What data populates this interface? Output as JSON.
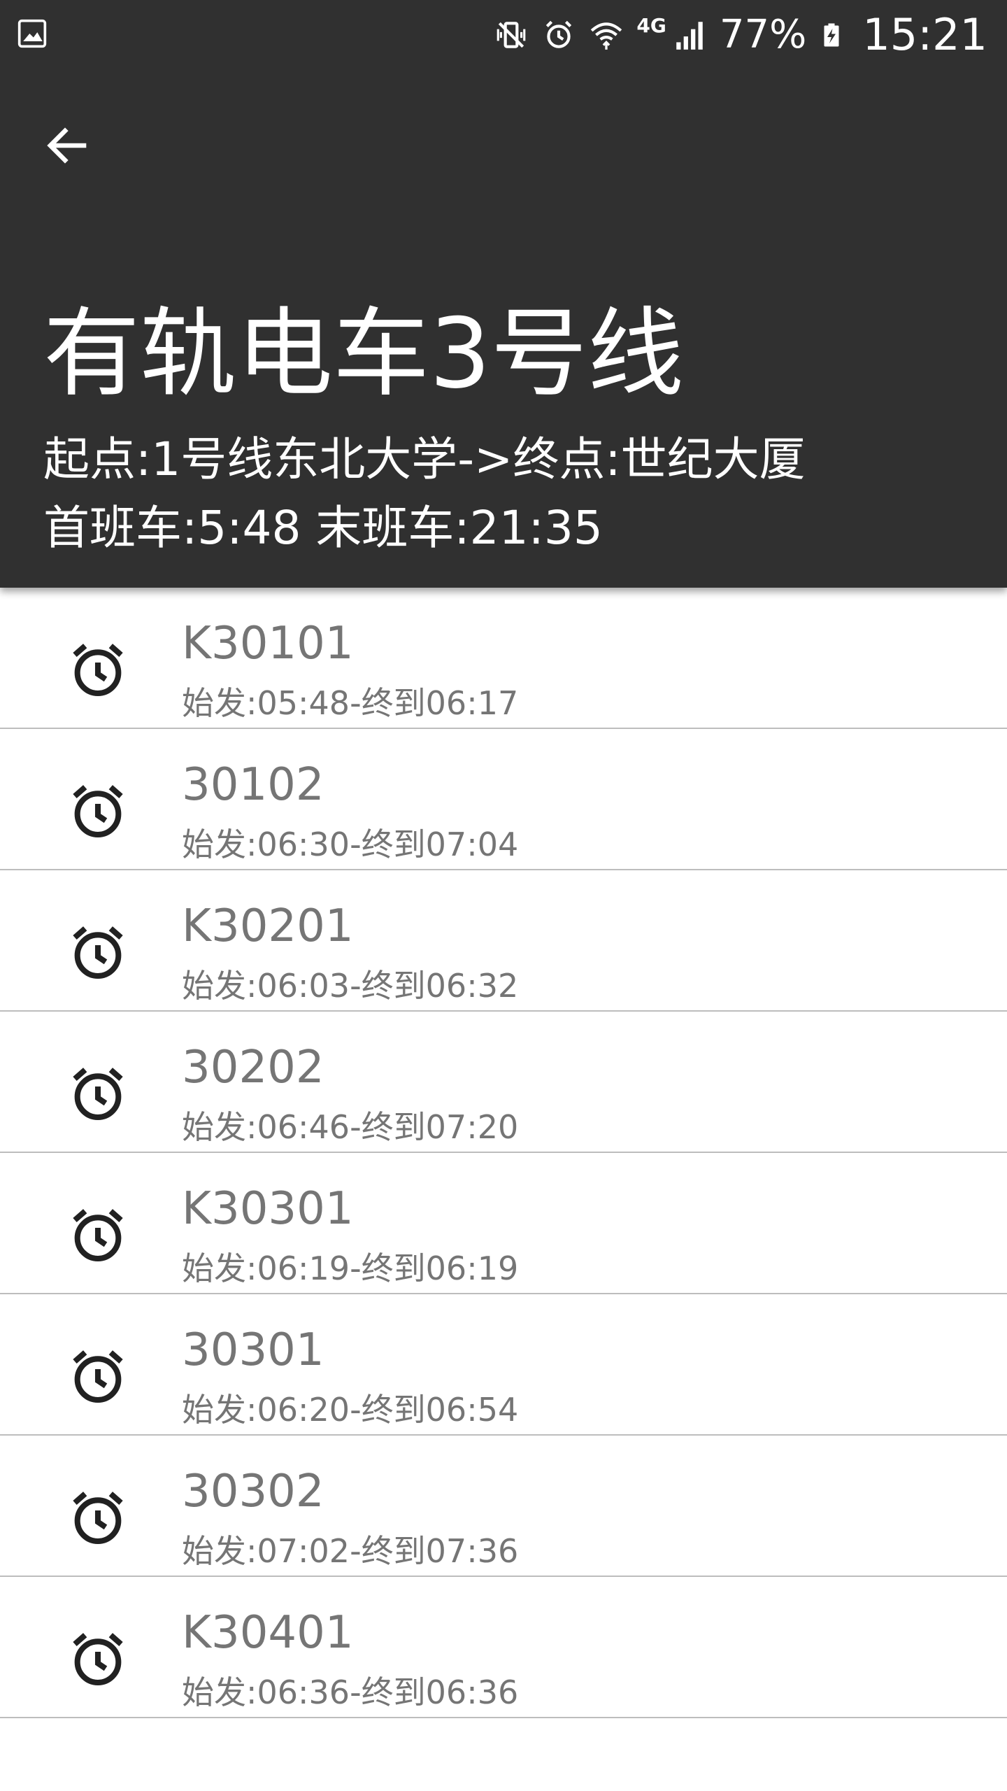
{
  "status_bar": {
    "network_type": "4G",
    "battery_percent": "77%",
    "time": "15:21",
    "icons": [
      "image-icon",
      "mute-vibrate-icon",
      "alarm-icon",
      "wifi-icon",
      "signal-icon",
      "battery-charging-icon"
    ]
  },
  "header": {
    "back_icon": "arrow-left-icon",
    "title": "有轨电车3号线",
    "route": "起点:1号线东北大学->终点:世纪大厦",
    "hours": "首班车:5:48 末班车:21:35"
  },
  "trips": [
    {
      "name": "K30101",
      "time": "始发:05:48-终到06:17"
    },
    {
      "name": "30102",
      "time": "始发:06:30-终到07:04"
    },
    {
      "name": "K30201",
      "time": "始发:06:03-终到06:32"
    },
    {
      "name": "30202",
      "time": "始发:06:46-终到07:20"
    },
    {
      "name": "K30301",
      "time": "始发:06:19-终到06:19"
    },
    {
      "name": "30301",
      "time": "始发:06:20-终到06:54"
    },
    {
      "name": "30302",
      "time": "始发:07:02-终到07:36"
    },
    {
      "name": "K30401",
      "time": "始发:06:36-终到06:36"
    }
  ],
  "colors": {
    "header_bg": "#303030",
    "header_text": "#ffffff",
    "list_text": "#757575",
    "divider": "#bdbdbd",
    "icon": "#212121"
  }
}
